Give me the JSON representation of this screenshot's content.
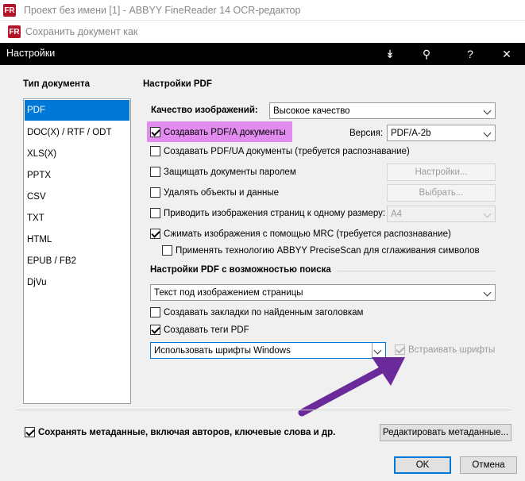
{
  "window": {
    "app_title": "Проект без имени [1] - ABBYY FineReader 14 OCR-редактор",
    "save_dialog_title": "Сохранить документ как",
    "app_icon_text": "FR"
  },
  "dialog": {
    "title": "Настройки",
    "controls": [
      "↡",
      "⚲",
      "?",
      "✕"
    ]
  },
  "doc_types": {
    "header": "Тип документа",
    "items": [
      "PDF",
      "DOC(X) / RTF / ODT",
      "XLS(X)",
      "PPTX",
      "CSV",
      "TXT",
      "HTML",
      "EPUB / FB2",
      "DjVu"
    ],
    "selected": "PDF"
  },
  "pdf": {
    "header": "Настройки PDF",
    "quality_label": "Качество изображений:",
    "quality_value": "Высокое качество",
    "pdfa_label": "Создавать PDF/A документы",
    "version_label": "Версия:",
    "version_value": "PDF/A-2b",
    "pdfua_label": "Создавать PDF/UA документы (требуется распознавание)",
    "password_label": "Защищать документы паролем",
    "password_button": "Настройки...",
    "remove_label": "Удалять объекты и данные",
    "remove_button": "Выбрать...",
    "resize_label": "Приводить изображения страниц к одному размеру:",
    "resize_value": "A4",
    "mrc_label": "Сжимать изображения с помощью MRC (требуется распознавание)",
    "precise_label": "Применять технологию ABBYY PreciseScan для сглаживания символов"
  },
  "search": {
    "header": "Настройки PDF с возможностью поиска",
    "mode_value": "Текст под изображением страницы",
    "bookmarks_label": "Создавать закладки по найденным заголовкам",
    "tags_label": "Создавать теги PDF",
    "fonts_value": "Использовать шрифты Windows",
    "embed_label": "Встраивать шрифты"
  },
  "footer": {
    "metadata_label": "Сохранять метаданные, включая авторов, ключевые слова и др.",
    "edit_metadata_button": "Редактировать метаданные...",
    "ok": "OK",
    "cancel": "Отмена"
  },
  "colors": {
    "highlight": "#e28cf0",
    "arrow": "#6a2a9a",
    "selection": "#0078d7"
  }
}
